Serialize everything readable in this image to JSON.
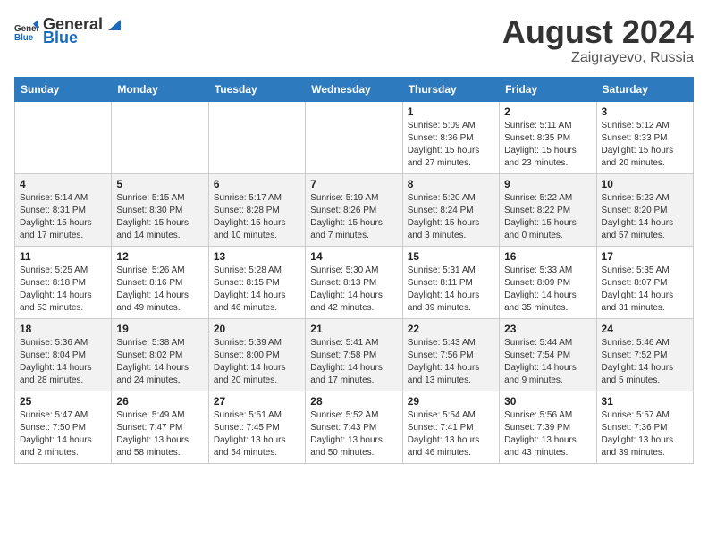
{
  "header": {
    "logo_general": "General",
    "logo_blue": "Blue",
    "month_year": "August 2024",
    "location": "Zaigrayevo, Russia"
  },
  "calendar": {
    "days_of_week": [
      "Sunday",
      "Monday",
      "Tuesday",
      "Wednesday",
      "Thursday",
      "Friday",
      "Saturday"
    ],
    "weeks": [
      [
        {
          "day": "",
          "sunrise": "",
          "sunset": "",
          "daylight": ""
        },
        {
          "day": "",
          "sunrise": "",
          "sunset": "",
          "daylight": ""
        },
        {
          "day": "",
          "sunrise": "",
          "sunset": "",
          "daylight": ""
        },
        {
          "day": "",
          "sunrise": "",
          "sunset": "",
          "daylight": ""
        },
        {
          "day": "1",
          "sunrise": "5:09 AM",
          "sunset": "8:36 PM",
          "daylight": "15 hours and 27 minutes."
        },
        {
          "day": "2",
          "sunrise": "5:11 AM",
          "sunset": "8:35 PM",
          "daylight": "15 hours and 23 minutes."
        },
        {
          "day": "3",
          "sunrise": "5:12 AM",
          "sunset": "8:33 PM",
          "daylight": "15 hours and 20 minutes."
        }
      ],
      [
        {
          "day": "4",
          "sunrise": "5:14 AM",
          "sunset": "8:31 PM",
          "daylight": "15 hours and 17 minutes."
        },
        {
          "day": "5",
          "sunrise": "5:15 AM",
          "sunset": "8:30 PM",
          "daylight": "15 hours and 14 minutes."
        },
        {
          "day": "6",
          "sunrise": "5:17 AM",
          "sunset": "8:28 PM",
          "daylight": "15 hours and 10 minutes."
        },
        {
          "day": "7",
          "sunrise": "5:19 AM",
          "sunset": "8:26 PM",
          "daylight": "15 hours and 7 minutes."
        },
        {
          "day": "8",
          "sunrise": "5:20 AM",
          "sunset": "8:24 PM",
          "daylight": "15 hours and 3 minutes."
        },
        {
          "day": "9",
          "sunrise": "5:22 AM",
          "sunset": "8:22 PM",
          "daylight": "15 hours and 0 minutes."
        },
        {
          "day": "10",
          "sunrise": "5:23 AM",
          "sunset": "8:20 PM",
          "daylight": "14 hours and 57 minutes."
        }
      ],
      [
        {
          "day": "11",
          "sunrise": "5:25 AM",
          "sunset": "8:18 PM",
          "daylight": "14 hours and 53 minutes."
        },
        {
          "day": "12",
          "sunrise": "5:26 AM",
          "sunset": "8:16 PM",
          "daylight": "14 hours and 49 minutes."
        },
        {
          "day": "13",
          "sunrise": "5:28 AM",
          "sunset": "8:15 PM",
          "daylight": "14 hours and 46 minutes."
        },
        {
          "day": "14",
          "sunrise": "5:30 AM",
          "sunset": "8:13 PM",
          "daylight": "14 hours and 42 minutes."
        },
        {
          "day": "15",
          "sunrise": "5:31 AM",
          "sunset": "8:11 PM",
          "daylight": "14 hours and 39 minutes."
        },
        {
          "day": "16",
          "sunrise": "5:33 AM",
          "sunset": "8:09 PM",
          "daylight": "14 hours and 35 minutes."
        },
        {
          "day": "17",
          "sunrise": "5:35 AM",
          "sunset": "8:07 PM",
          "daylight": "14 hours and 31 minutes."
        }
      ],
      [
        {
          "day": "18",
          "sunrise": "5:36 AM",
          "sunset": "8:04 PM",
          "daylight": "14 hours and 28 minutes."
        },
        {
          "day": "19",
          "sunrise": "5:38 AM",
          "sunset": "8:02 PM",
          "daylight": "14 hours and 24 minutes."
        },
        {
          "day": "20",
          "sunrise": "5:39 AM",
          "sunset": "8:00 PM",
          "daylight": "14 hours and 20 minutes."
        },
        {
          "day": "21",
          "sunrise": "5:41 AM",
          "sunset": "7:58 PM",
          "daylight": "14 hours and 17 minutes."
        },
        {
          "day": "22",
          "sunrise": "5:43 AM",
          "sunset": "7:56 PM",
          "daylight": "14 hours and 13 minutes."
        },
        {
          "day": "23",
          "sunrise": "5:44 AM",
          "sunset": "7:54 PM",
          "daylight": "14 hours and 9 minutes."
        },
        {
          "day": "24",
          "sunrise": "5:46 AM",
          "sunset": "7:52 PM",
          "daylight": "14 hours and 5 minutes."
        }
      ],
      [
        {
          "day": "25",
          "sunrise": "5:47 AM",
          "sunset": "7:50 PM",
          "daylight": "14 hours and 2 minutes."
        },
        {
          "day": "26",
          "sunrise": "5:49 AM",
          "sunset": "7:47 PM",
          "daylight": "13 hours and 58 minutes."
        },
        {
          "day": "27",
          "sunrise": "5:51 AM",
          "sunset": "7:45 PM",
          "daylight": "13 hours and 54 minutes."
        },
        {
          "day": "28",
          "sunrise": "5:52 AM",
          "sunset": "7:43 PM",
          "daylight": "13 hours and 50 minutes."
        },
        {
          "day": "29",
          "sunrise": "5:54 AM",
          "sunset": "7:41 PM",
          "daylight": "13 hours and 46 minutes."
        },
        {
          "day": "30",
          "sunrise": "5:56 AM",
          "sunset": "7:39 PM",
          "daylight": "13 hours and 43 minutes."
        },
        {
          "day": "31",
          "sunrise": "5:57 AM",
          "sunset": "7:36 PM",
          "daylight": "13 hours and 39 minutes."
        }
      ]
    ]
  }
}
